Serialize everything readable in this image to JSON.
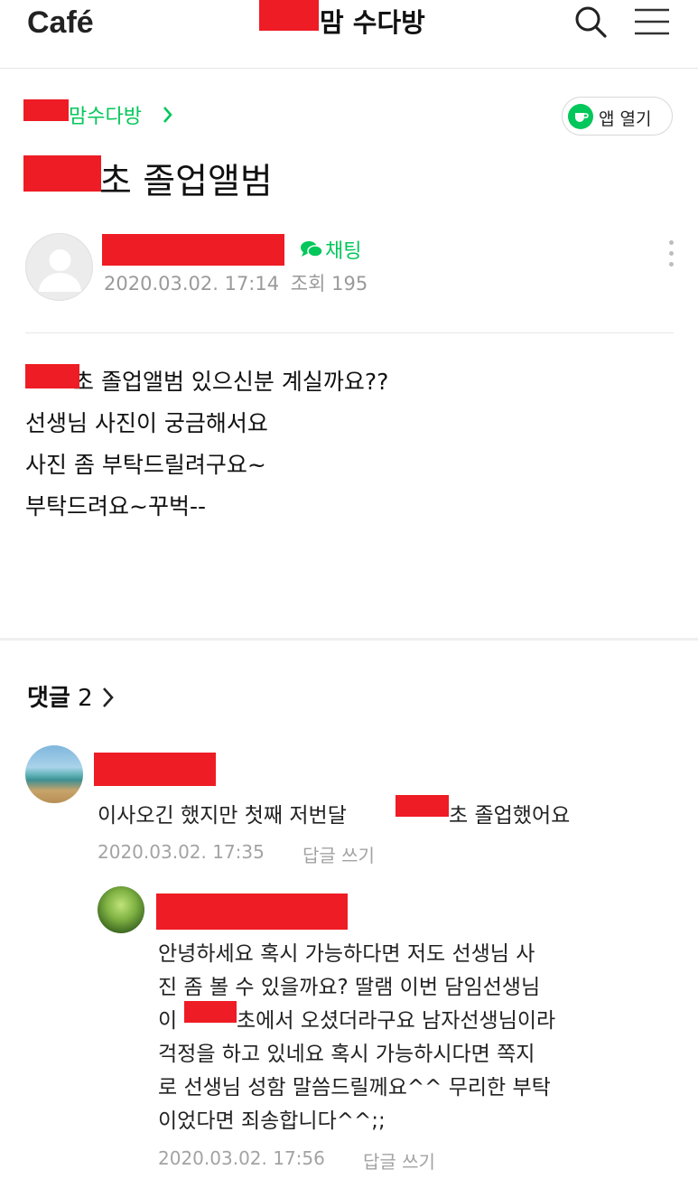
{
  "header": {
    "logo": "Café",
    "cafe_name": "맘 수다방"
  },
  "post": {
    "breadcrumb": "맘수다방",
    "open_app_label": "앱 열기",
    "title": "초 졸업앨범",
    "chat_label": "채팅",
    "date": "2020.03.02. 17:14",
    "views_label": "조회",
    "views": "195",
    "body": [
      "초 졸업앨범 있으신분 계실까요??",
      "선생님 사진이 궁금해서요",
      "사진 좀 부탁드릴려구요~",
      "부탁드려요~꾸벅--"
    ]
  },
  "comments": {
    "label": "댓글",
    "count": "2",
    "items": [
      {
        "text_before": "이사오긴 했지만 첫째 저번달",
        "text_after": "초 졸업했어요",
        "date": "2020.03.02. 17:35",
        "reply_label": "답글 쓰기"
      },
      {
        "lines": [
          "안녕하세요 혹시 가능하다면 저도 선생님 사",
          "진 좀 볼 수 있을까요? 딸램 이번 담임선생님",
          "이",
          "초에서 오셨더라구요 남자선생님이라",
          "걱정을 하고 있네요 혹시 가능하시다면 쪽지",
          "로 선생님 성함 말씀드릴께요^^ 무리한 부탁",
          "이었다면 죄송합니다^^;;"
        ],
        "date": "2020.03.02. 17:56",
        "reply_label": "답글 쓰기"
      }
    ]
  },
  "colors": {
    "accent_green": "#03c75a",
    "redaction": "#ee1c24"
  },
  "icons": [
    "search-icon",
    "menu-icon",
    "chevron-right-icon",
    "chat-bubble-icon",
    "coffee-cup-icon",
    "more-vertical-icon",
    "default-avatar-icon"
  ]
}
